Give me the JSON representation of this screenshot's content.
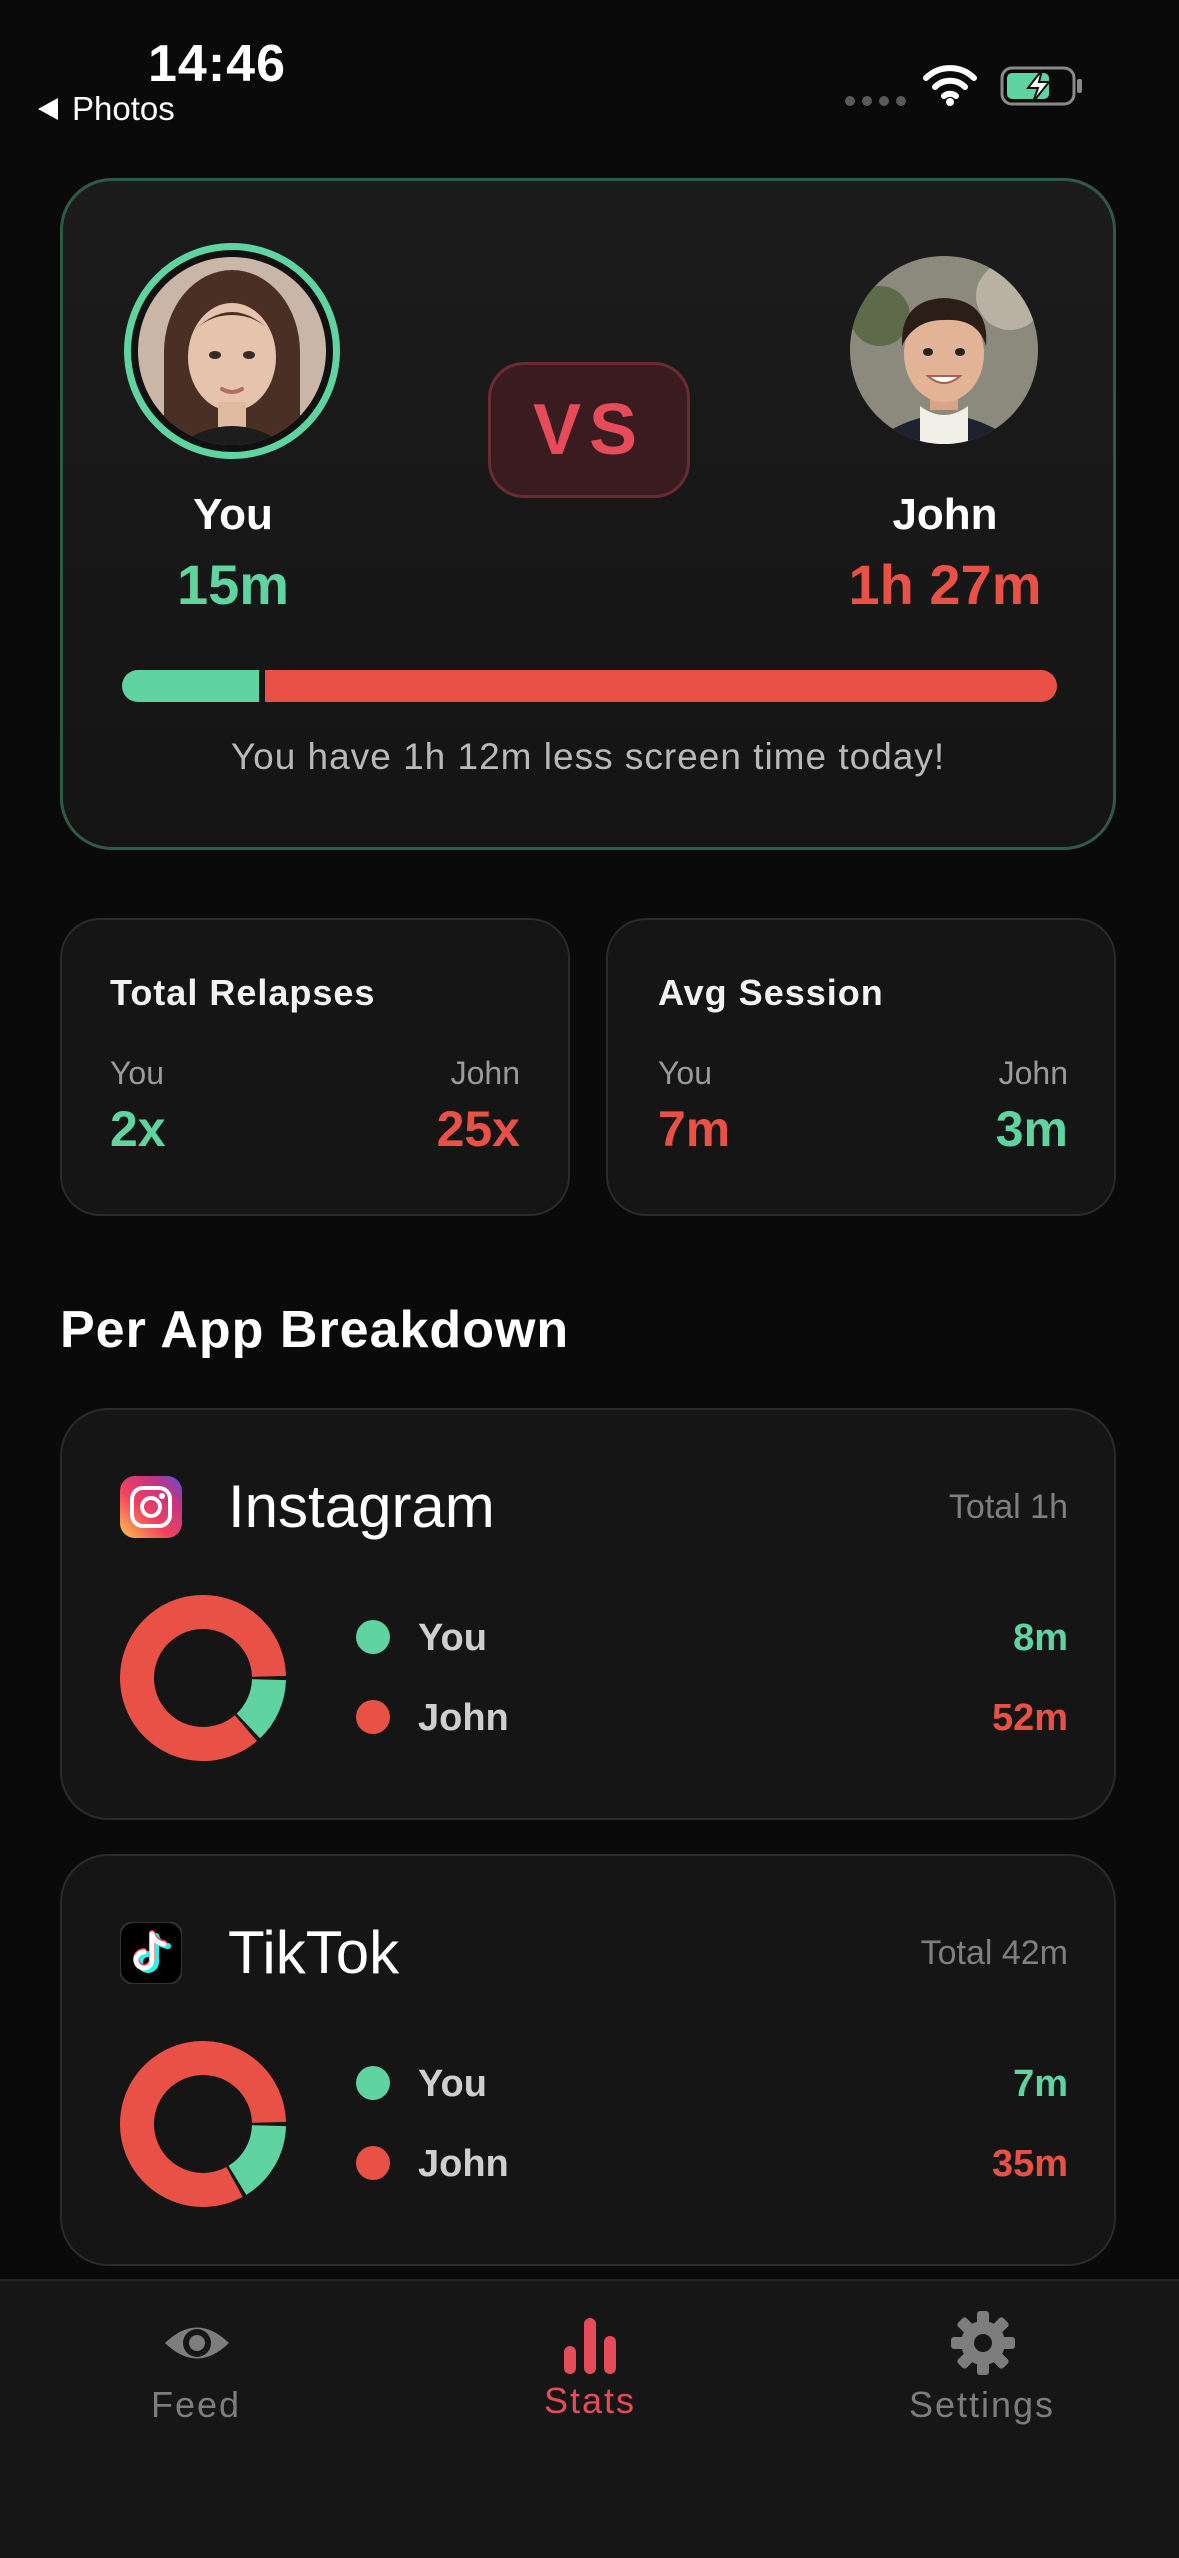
{
  "status_bar": {
    "time": "14:46",
    "back_label": "Photos"
  },
  "versus": {
    "badge": "VS",
    "you": {
      "name": "You",
      "time": "15m"
    },
    "john": {
      "name": "John",
      "time": "1h 27m"
    },
    "you_share": 0.147,
    "message": "You have 1h 12m less screen time today!"
  },
  "stats": [
    {
      "title": "Total Relapses",
      "you_label": "You",
      "john_label": "John",
      "you_value": "2x",
      "john_value": "25x"
    },
    {
      "title": "Avg Session",
      "you_label": "You",
      "john_label": "John",
      "you_value": "7m",
      "john_value": "3m"
    }
  ],
  "breakdown": {
    "title": "Per App Breakdown",
    "apps": [
      {
        "name": "Instagram",
        "total": "Total 1h",
        "you_label": "You",
        "john_label": "John",
        "you_value": "8m",
        "john_value": "52m",
        "you_minutes": 8,
        "john_minutes": 52
      },
      {
        "name": "TikTok",
        "total": "Total 42m",
        "you_label": "You",
        "john_label": "John",
        "you_value": "7m",
        "john_value": "35m",
        "you_minutes": 7,
        "john_minutes": 35
      }
    ]
  },
  "tabs": [
    {
      "label": "Feed",
      "icon": "eye-icon",
      "active": false
    },
    {
      "label": "Stats",
      "icon": "bar-chart-icon",
      "active": true
    },
    {
      "label": "Settings",
      "icon": "gear-icon",
      "active": false
    }
  ],
  "colors": {
    "you": "#5fd3a0",
    "john": "#ea5146",
    "accent": "#e64b5a"
  }
}
